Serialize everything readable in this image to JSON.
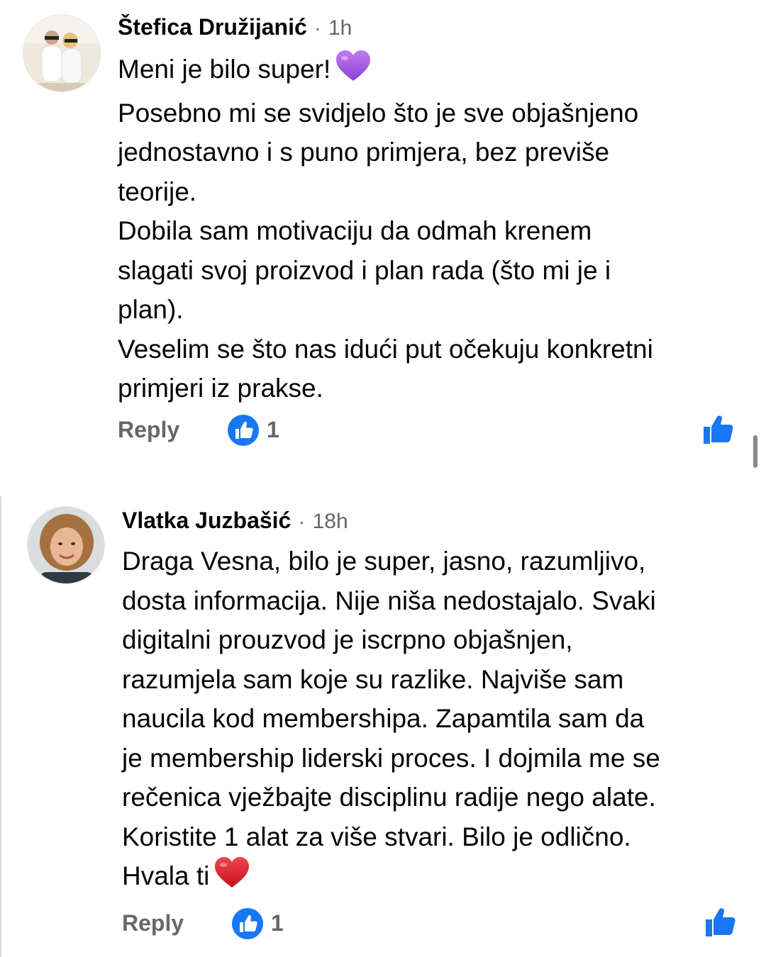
{
  "comments": [
    {
      "author": "Štefica Družijanić",
      "separator": "·",
      "time": "1h",
      "lines": [
        "Meni je bilo super!",
        "Posebno mi se svidjelo što je sve objašnjeno",
        "jednostavno i s puno primjera, bez previše",
        "teorije.",
        "Dobila sam motivaciju da odmah krenem",
        "slagati svoj proizvod i plan rada (što mi je i",
        "plan).",
        "Veselim se što nas idući put očekuju konkretni",
        "primjeri iz prakse."
      ],
      "emoji": "purple-heart",
      "reply_label": "Reply",
      "reaction_count": "1"
    },
    {
      "author": "Vlatka Juzbašić",
      "separator": "·",
      "time": "18h",
      "lines": [
        "Draga Vesna, bilo je super, jasno, razumljivo,",
        "dosta informacija. Nije niša nedostajalo. Svaki",
        "digitalni prouzvod je iscrpno objašnjen,",
        "razumjela sam koje su razlike. Najviše sam",
        "naucila kod membershipa. Zapamtila sam da",
        "je membership liderski proces. I dojmila me se",
        "rečenica vježbajte disciplinu radije nego alate.",
        "Koristite 1 alat za više stvari. Bilo je odlično.",
        "Hvala ti"
      ],
      "emoji": "red-heart",
      "reply_label": "Reply",
      "reaction_count": "1"
    }
  ],
  "colors": {
    "like_blue": "#1877f2",
    "secondary_text": "#65676b",
    "primary_text": "#050505",
    "purple_heart": "#9b4dde",
    "red_heart": "#e0202c"
  }
}
